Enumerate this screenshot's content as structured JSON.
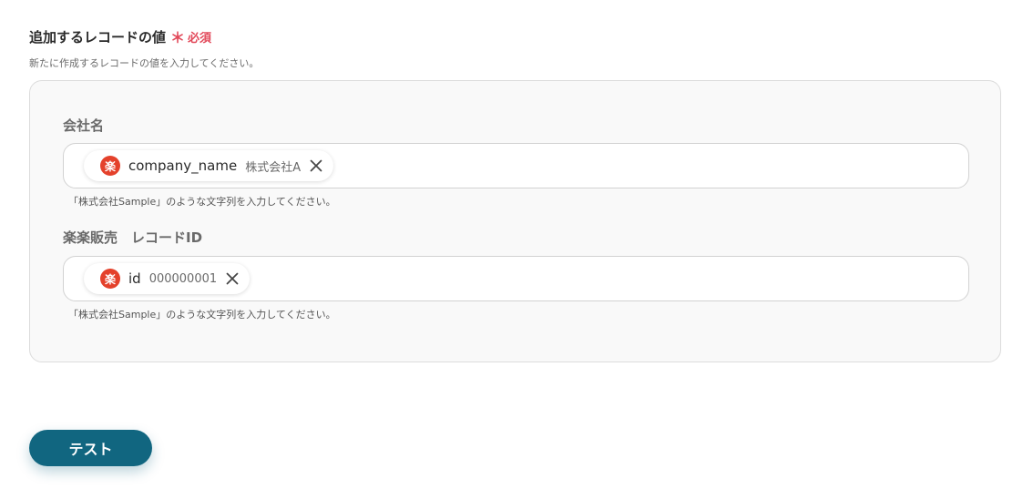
{
  "section": {
    "title": "追加するレコードの値",
    "required_label": "必須",
    "required_mark": "＊",
    "description": "新たに作成するレコードの値を入力してください。"
  },
  "fields": [
    {
      "label": "会社名",
      "chip": {
        "icon": "rakuten-icon",
        "icon_glyph": "楽",
        "name": "company_name",
        "value": "株式会社A"
      },
      "hint": "「株式会社Sample」のような文字列を入力してください。"
    },
    {
      "label": "楽楽販売　レコードID",
      "chip": {
        "icon": "rakuten-icon",
        "icon_glyph": "楽",
        "name": "id",
        "value": "000000001"
      },
      "hint": "「株式会社Sample」のような文字列を入力してください。"
    }
  ],
  "actions": {
    "test_label": "テスト"
  },
  "colors": {
    "accent": "#116680",
    "required": "#e2495a",
    "chip_icon": "#e4412b",
    "panel_bg": "#f9f9f9"
  }
}
